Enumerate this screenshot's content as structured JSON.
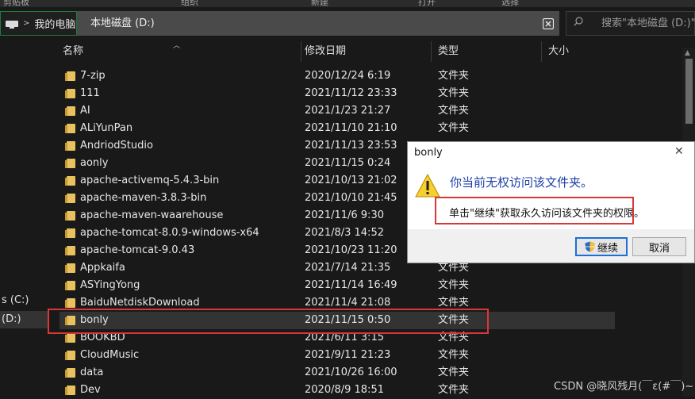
{
  "ribbon": {
    "labels": [
      "剪贴板",
      "组织",
      "新建",
      "打开",
      "选择"
    ]
  },
  "address": {
    "home_label": "我的电脑",
    "separator": ">",
    "drive_label": "本地磁盘 (D:)"
  },
  "search": {
    "placeholder": "搜索\"本地磁盘 (D:)\""
  },
  "nav": {
    "c_drive": "s (C:)",
    "d_drive": "(D:)"
  },
  "columns": {
    "name": "名称",
    "date": "修改日期",
    "type": "类型",
    "size": "大小"
  },
  "files": [
    {
      "name": "7-zip",
      "date": "2020/12/24 6:19",
      "type": "文件夹"
    },
    {
      "name": "111",
      "date": "2021/11/12 23:33",
      "type": "文件夹"
    },
    {
      "name": "AI",
      "date": "2021/1/23 21:27",
      "type": "文件夹"
    },
    {
      "name": "ALiYunPan",
      "date": "2021/11/10 21:10",
      "type": "文件夹"
    },
    {
      "name": "AndriodStudio",
      "date": "2021/11/13 23:53",
      "type": ""
    },
    {
      "name": "aonly",
      "date": "2021/11/15 0:24",
      "type": ""
    },
    {
      "name": "apache-activemq-5.4.3-bin",
      "date": "2021/10/13 21:02",
      "type": ""
    },
    {
      "name": "apache-maven-3.8.3-bin",
      "date": "2021/10/10 21:45",
      "type": ""
    },
    {
      "name": "apache-maven-waarehouse",
      "date": "2021/11/6 9:30",
      "type": ""
    },
    {
      "name": "apache-tomcat-8.0.9-windows-x64",
      "date": "2021/8/3 14:52",
      "type": ""
    },
    {
      "name": "apache-tomcat-9.0.43",
      "date": "2021/10/23 11:20",
      "type": ""
    },
    {
      "name": "Appkaifa",
      "date": "2021/7/14 21:35",
      "type": "文件夹"
    },
    {
      "name": "ASYingYong",
      "date": "2021/11/14 16:49",
      "type": "文件夹"
    },
    {
      "name": "BaiduNetdiskDownload",
      "date": "2021/11/4 21:08",
      "type": "文件夹"
    },
    {
      "name": "bonly",
      "date": "2021/11/15 0:50",
      "type": "文件夹"
    },
    {
      "name": "BOOKBD",
      "date": "2021/6/11 3:15",
      "type": "文件夹"
    },
    {
      "name": "CloudMusic",
      "date": "2021/9/11 21:23",
      "type": "文件夹"
    },
    {
      "name": "data",
      "date": "2021/10/26 16:00",
      "type": "文件夹"
    },
    {
      "name": "Dev",
      "date": "2020/8/9 18:51",
      "type": "文件夹"
    }
  ],
  "dialog": {
    "title": "bonly",
    "close": "✕",
    "main_text": "你当前无权访问该文件夹。",
    "sub_text": "单击\"继续\"获取永久访问该文件夹的权限。",
    "continue_label": "继续",
    "cancel_label": "取消"
  },
  "watermark": "CSDN @晓风残月(￣ε(#￣)~",
  "colors": {
    "highlight": "#d93838",
    "accent_blue": "#1c3fa8",
    "folder": "#e8c25f"
  }
}
